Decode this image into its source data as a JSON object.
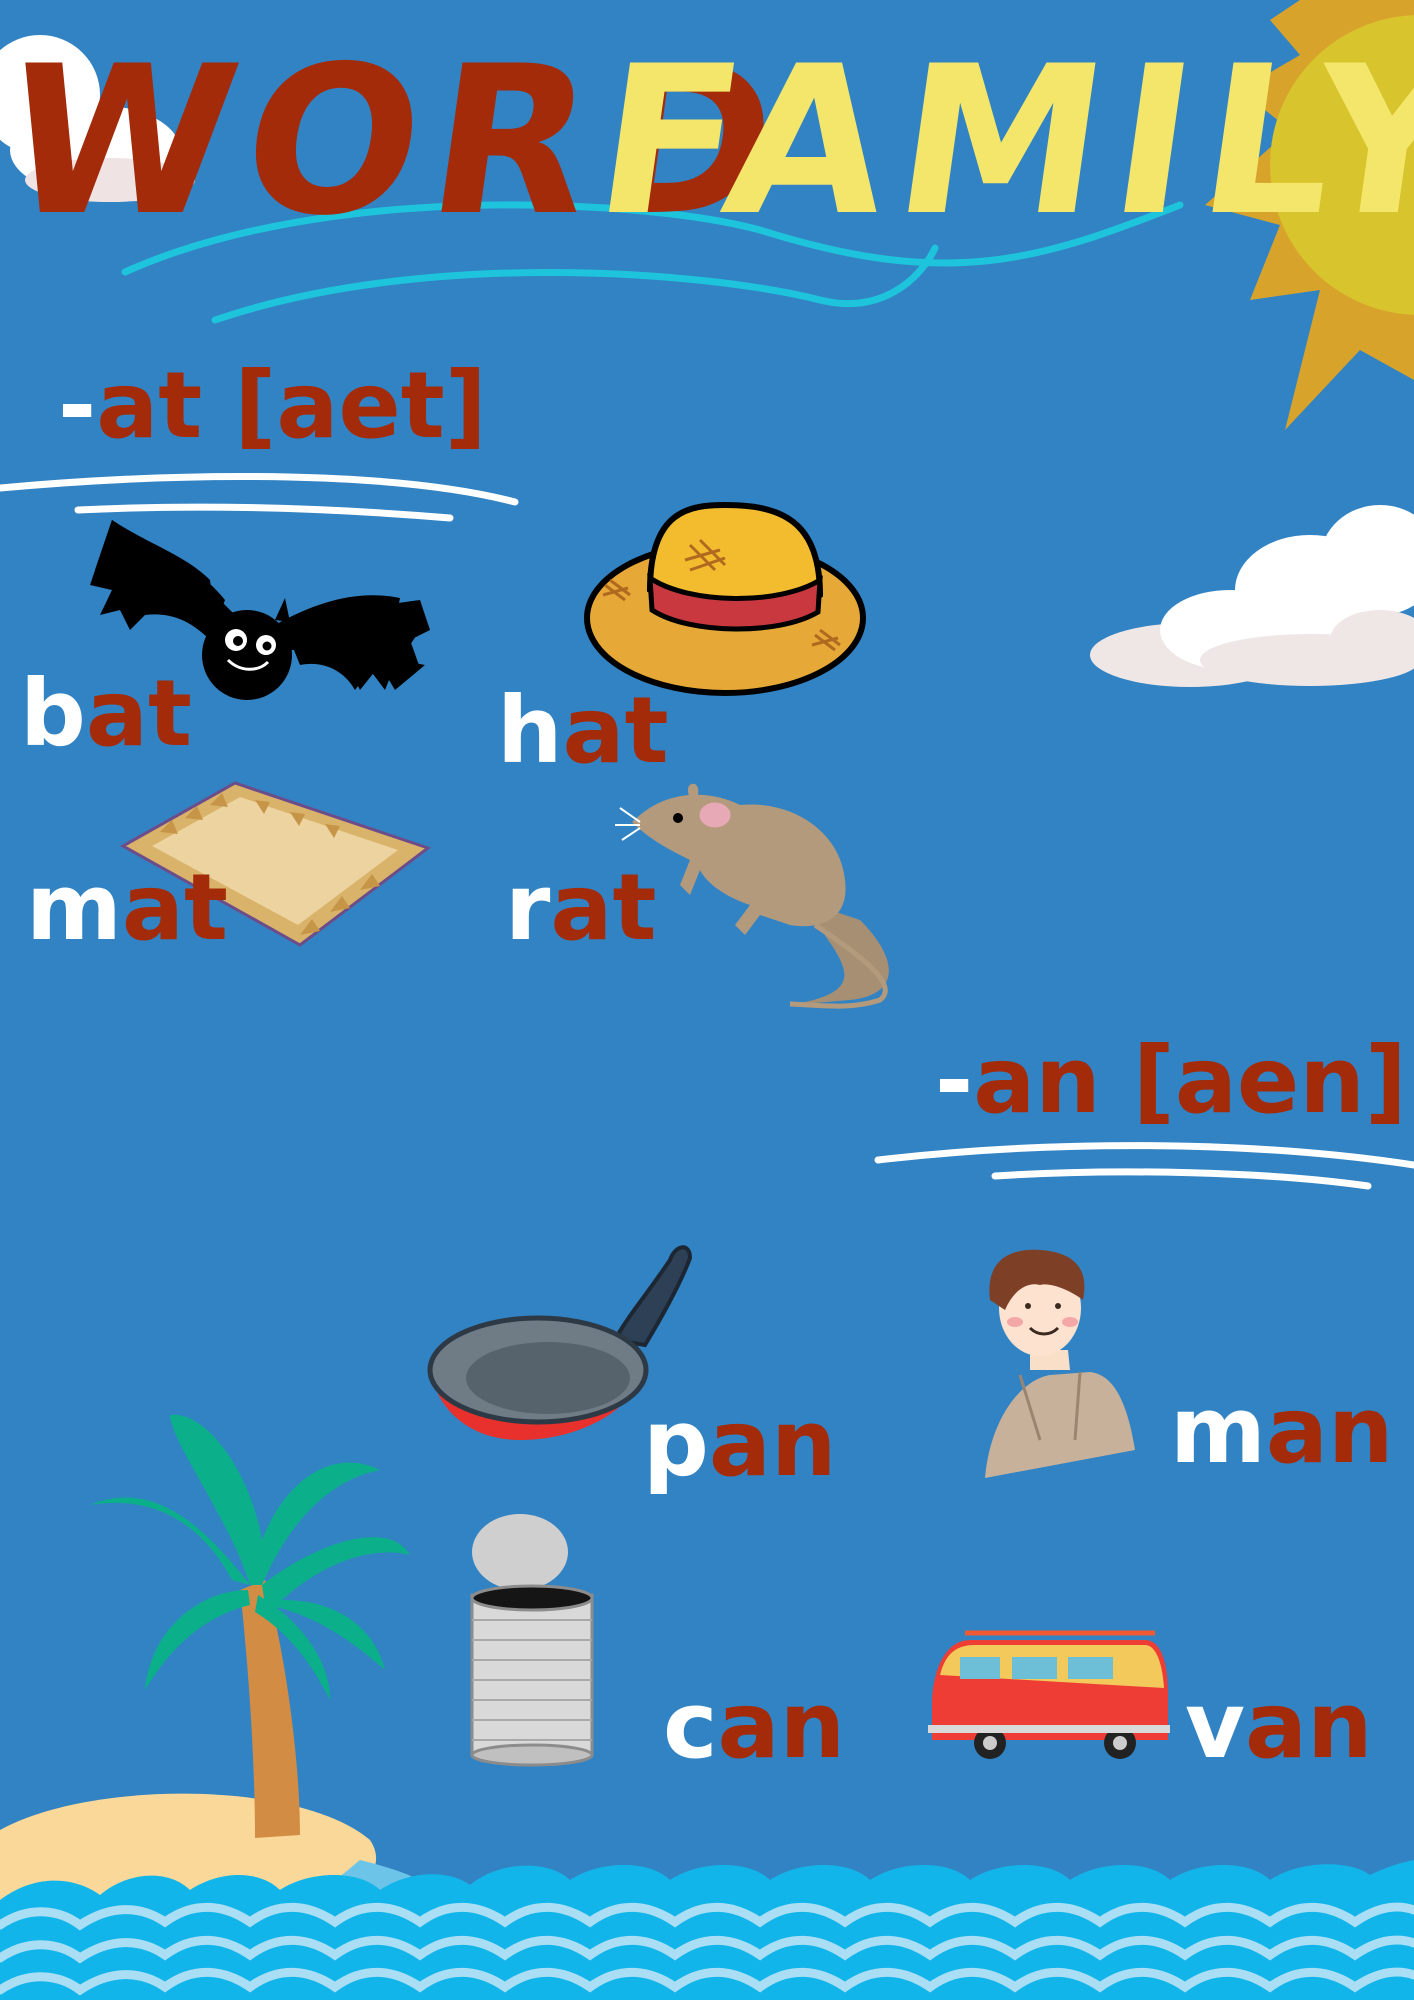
{
  "title": {
    "word1": "WORD",
    "word2": "FAMILY"
  },
  "colors": {
    "background": "#3283c3",
    "title_word1": "#a32b0a",
    "title_word2": "#f4e66a",
    "onset": "#ffffff",
    "rime": "#a32b0a",
    "wave_line": "#1ec3dc",
    "sun": "#d7a32a",
    "water": "#12b5ea"
  },
  "sections": {
    "at": {
      "dash": "-",
      "ending": "at",
      "pronunciation": "[aet]",
      "words": [
        {
          "onset": "b",
          "rime": "at",
          "picture": "bat-icon"
        },
        {
          "onset": "h",
          "rime": "at",
          "picture": "hat-icon"
        },
        {
          "onset": "m",
          "rime": "at",
          "picture": "mat-icon"
        },
        {
          "onset": "r",
          "rime": "at",
          "picture": "rat-icon"
        }
      ]
    },
    "an": {
      "dash": "-",
      "ending": "an",
      "pronunciation": "[aen]",
      "words": [
        {
          "onset": "p",
          "rime": "an",
          "picture": "pan-icon"
        },
        {
          "onset": "m",
          "rime": "an",
          "picture": "man-icon"
        },
        {
          "onset": "c",
          "rime": "an",
          "picture": "can-icon"
        },
        {
          "onset": "v",
          "rime": "an",
          "picture": "van-icon"
        }
      ]
    }
  },
  "decorations": [
    "sun-icon",
    "cloud-icon",
    "palm-tree-icon",
    "island-icon",
    "ocean-waves"
  ]
}
